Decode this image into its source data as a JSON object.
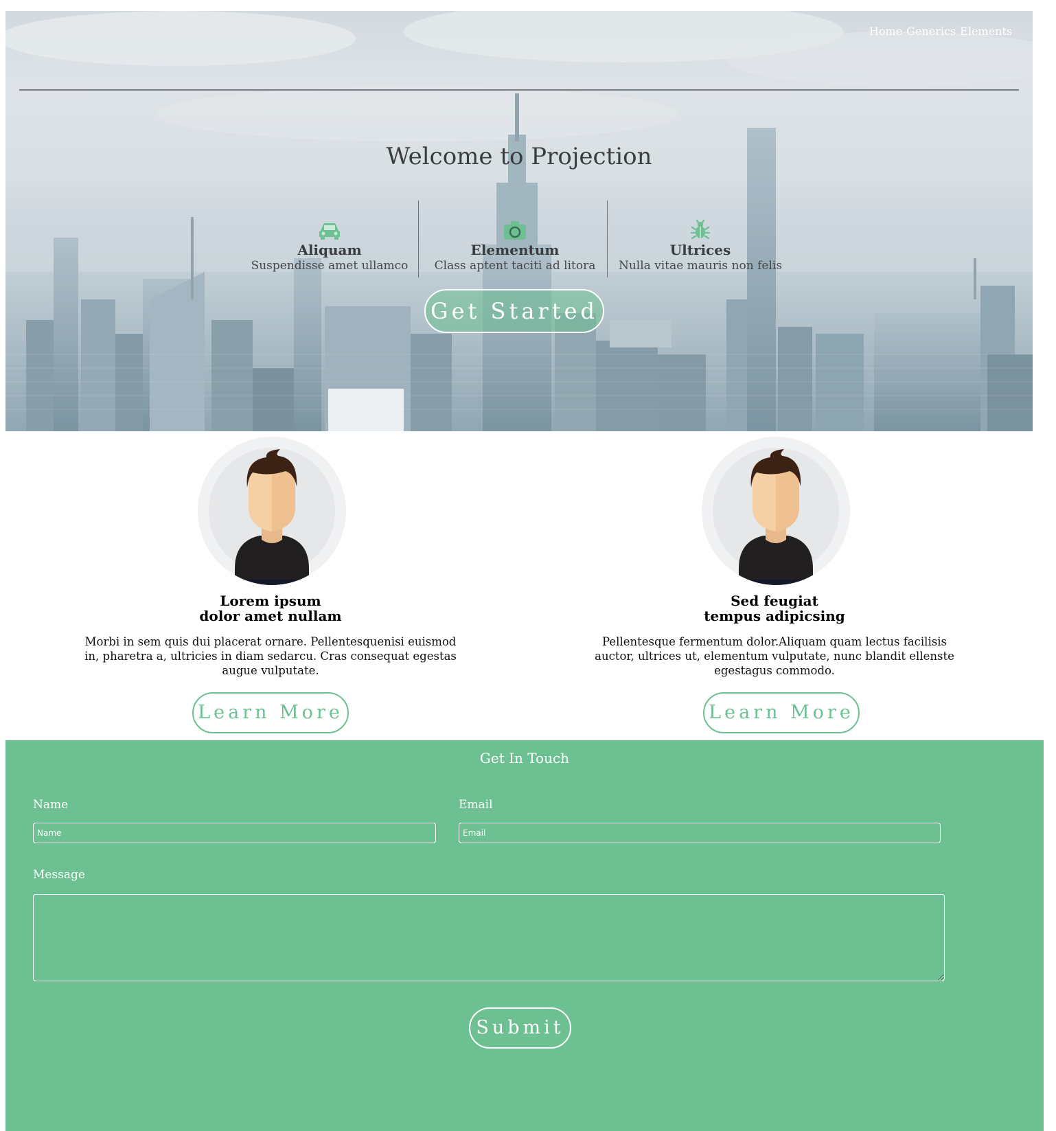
{
  "nav": {
    "items": [
      "Home",
      "Generics",
      "Elements"
    ]
  },
  "hero": {
    "title": "Welcome to Projection",
    "features": [
      {
        "icon": "car-icon",
        "title": "Aliquam",
        "desc": "Suspendisse amet ullamco"
      },
      {
        "icon": "camera-icon",
        "title": "Elementum",
        "desc": "Class aptent taciti ad litora"
      },
      {
        "icon": "bug-icon",
        "title": "Ultrices",
        "desc": "Nulla vitae mauris non felis"
      }
    ],
    "cta_label": "Get Started"
  },
  "profiles": [
    {
      "name_line1": "Lorem ipsum",
      "name_line2": "dolor amet nullam",
      "desc": "Morbi in sem quis dui placerat ornare. Pellentesquenisi euismod in, pharetra a, ultricies in diam sedarcu. Cras consequat egestas augue vulputate.",
      "button_label": "Learn More"
    },
    {
      "name_line1": "Sed feugiat",
      "name_line2": "tempus adipicsing",
      "desc": "Pellentesque fermentum dolor.Aliquam quam lectus facilisis auctor, ultrices ut, elementum vulputate, nunc blandit ellenste egestagus commodo.",
      "button_label": "Learn More"
    }
  ],
  "contact": {
    "title": "Get In Touch",
    "name_label": "Name",
    "name_placeholder": "Name",
    "email_label": "Email",
    "email_placeholder": "Email",
    "message_label": "Message",
    "submit_label": "Submit"
  },
  "colors": {
    "accent": "#6cc091",
    "hero_text": "#3a3d40"
  }
}
